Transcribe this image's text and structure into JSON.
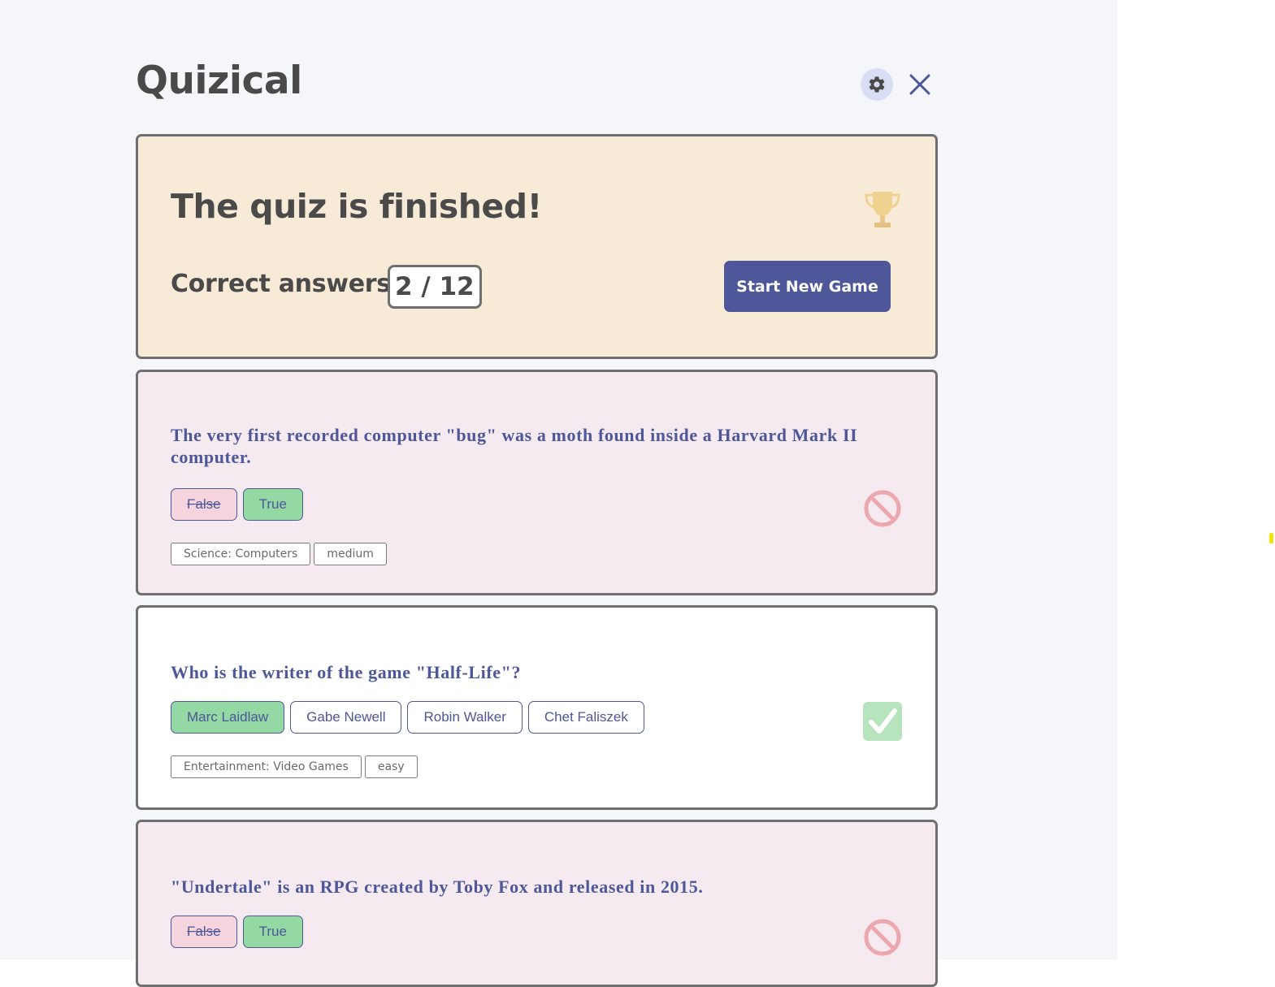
{
  "app": {
    "title": "Quizical"
  },
  "header": {
    "settings_icon": "gear-icon",
    "close_icon": "close-icon"
  },
  "result": {
    "title": "The quiz is finished!",
    "score_label": "Correct answers:",
    "score_value": "2 / 12",
    "new_game_label": "Start New Game",
    "icon": "trophy-icon"
  },
  "questions": [
    {
      "text": "The very first recorded computer \"bug\" was a moth found inside a Harvard Mark II computer.",
      "answers": [
        {
          "label": "False",
          "state": "wrong"
        },
        {
          "label": "True",
          "state": "correct"
        }
      ],
      "category": "Science: Computers",
      "difficulty": "medium",
      "status_icon": "prohibited-icon",
      "result": "incorrect"
    },
    {
      "text": "Who is the writer of the game \"Half-Life\"?",
      "answers": [
        {
          "label": "Marc Laidlaw",
          "state": "correct"
        },
        {
          "label": "Gabe Newell",
          "state": "neutral"
        },
        {
          "label": "Robin Walker",
          "state": "neutral"
        },
        {
          "label": "Chet Faliszek",
          "state": "neutral"
        }
      ],
      "category": "Entertainment: Video Games",
      "difficulty": "easy",
      "status_icon": "check-mark-icon",
      "result": "correct"
    },
    {
      "text": "\"Undertale\" is an RPG created by Toby Fox and released in 2015.",
      "answers": [
        {
          "label": "False",
          "state": "wrong"
        },
        {
          "label": "True",
          "state": "correct"
        }
      ],
      "status_icon": "prohibited-icon",
      "result": "incorrect"
    }
  ],
  "colors": {
    "accent": "#4d5799",
    "correct": "#94d8a4",
    "wrong": "#f6d4dd",
    "result_card": "#f7ebd8",
    "incorrect_card": "#f5eaef",
    "text_dark": "#4a4a4a"
  }
}
